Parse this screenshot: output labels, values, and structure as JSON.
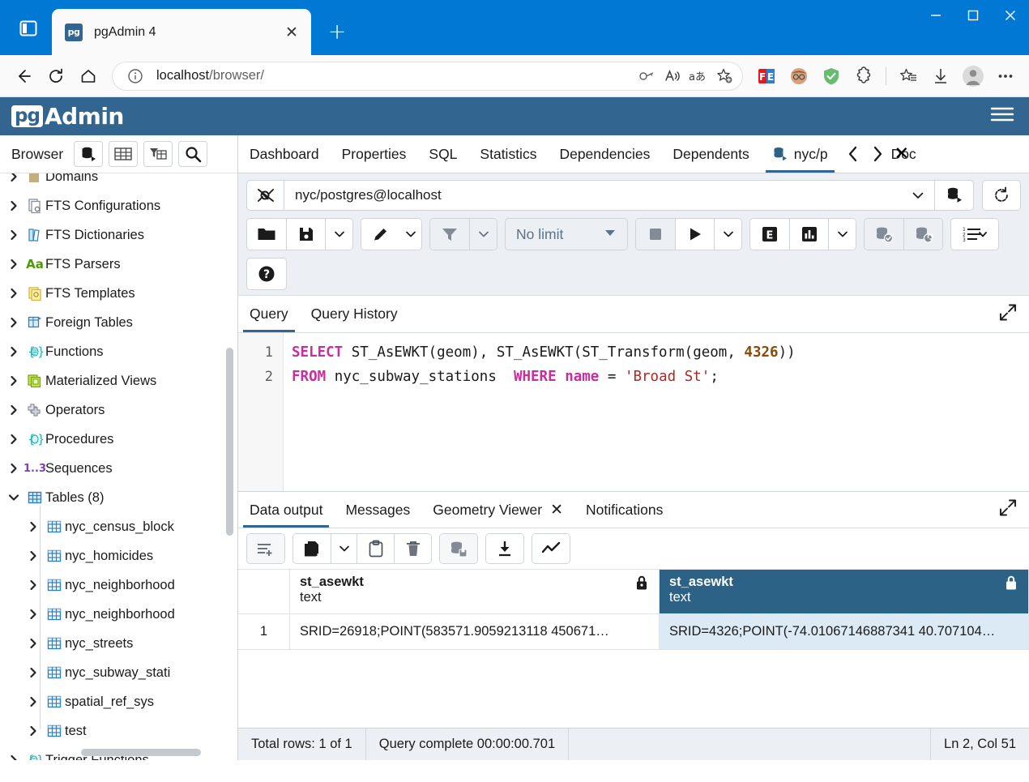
{
  "browser": {
    "tab": {
      "title": "pgAdmin 4",
      "favicon_label": "pg",
      "close_label": "✕"
    },
    "new_tab_label": "+",
    "window_controls": {
      "minimize": "—",
      "maximize": "☐",
      "close": "✕"
    },
    "url": {
      "host": "localhost",
      "path": "/browser/"
    },
    "icons": {
      "tab_list": "tab-list-icon",
      "back": "back-arrow-icon",
      "refresh": "refresh-icon",
      "home": "home-icon",
      "info": "info-icon",
      "key": "password-key-icon",
      "read_aloud": "read-aloud-icon",
      "translate": "translate-icon",
      "add_favorite": "add-favorite-star-icon",
      "ext_f3": "fe-extension-icon",
      "ext_avatar": "avatar-extension-icon",
      "ext_shield": "adguard-shield-icon",
      "ext_puzzle": "extensions-puzzle-icon",
      "collections": "collections-star-icon",
      "downloads": "downloads-icon",
      "profile": "profile-avatar-icon",
      "settings_more": "more-options-icon"
    }
  },
  "pgadmin": {
    "brand_pg": "pg",
    "brand_admin": "Admin",
    "hamburger": "menu-icon"
  },
  "sidebar": {
    "title": "Browser",
    "buttons": [
      {
        "name": "object-explorer-button",
        "icon": "database-stack-icon"
      },
      {
        "name": "view-data-button",
        "icon": "table-grid-icon"
      },
      {
        "name": "filter-button",
        "icon": "filter-table-icon"
      },
      {
        "name": "search-objects-button",
        "icon": "search-icon"
      }
    ],
    "tree": [
      {
        "label": "Domains",
        "icon": "domain-icon",
        "expanded": false,
        "indent": 0,
        "clipped": true
      },
      {
        "label": "FTS Configurations",
        "icon": "fts-config-icon",
        "expanded": false,
        "indent": 0
      },
      {
        "label": "FTS Dictionaries",
        "icon": "fts-dictionary-icon",
        "expanded": false,
        "indent": 0
      },
      {
        "label": "FTS Parsers",
        "icon": "fts-parser-icon",
        "expanded": false,
        "indent": 0
      },
      {
        "label": "FTS Templates",
        "icon": "fts-template-icon",
        "expanded": false,
        "indent": 0
      },
      {
        "label": "Foreign Tables",
        "icon": "foreign-table-icon",
        "expanded": false,
        "indent": 0
      },
      {
        "label": "Functions",
        "icon": "function-icon",
        "expanded": false,
        "indent": 0
      },
      {
        "label": "Materialized Views",
        "icon": "materialized-view-icon",
        "expanded": false,
        "indent": 0
      },
      {
        "label": "Operators",
        "icon": "operator-icon",
        "expanded": false,
        "indent": 0
      },
      {
        "label": "Procedures",
        "icon": "procedure-icon",
        "expanded": false,
        "indent": 0
      },
      {
        "label": "Sequences",
        "icon": "sequence-icon",
        "expanded": false,
        "indent": 0
      },
      {
        "label": "Tables (8)",
        "icon": "tables-icon",
        "expanded": true,
        "indent": 0
      },
      {
        "label": "nyc_census_block",
        "icon": "table-icon",
        "expanded": false,
        "indent": 1
      },
      {
        "label": "nyc_homicides",
        "icon": "table-icon",
        "expanded": false,
        "indent": 1
      },
      {
        "label": "nyc_neighborhood",
        "icon": "table-icon",
        "expanded": false,
        "indent": 1
      },
      {
        "label": "nyc_neighborhood",
        "icon": "table-icon",
        "expanded": false,
        "indent": 1
      },
      {
        "label": "nyc_streets",
        "icon": "table-icon",
        "expanded": false,
        "indent": 1
      },
      {
        "label": "nyc_subway_stati",
        "icon": "table-icon",
        "expanded": false,
        "indent": 1
      },
      {
        "label": "spatial_ref_sys",
        "icon": "table-icon",
        "expanded": false,
        "indent": 1
      },
      {
        "label": "test",
        "icon": "table-icon",
        "expanded": false,
        "indent": 1
      },
      {
        "label": "Trigger Functions",
        "icon": "trigger-function-icon",
        "expanded": false,
        "indent": 0
      }
    ]
  },
  "object_tabs": {
    "items": [
      {
        "label": "Dashboard",
        "active": false
      },
      {
        "label": "Properties",
        "active": false
      },
      {
        "label": "SQL",
        "active": false
      },
      {
        "label": "Statistics",
        "active": false
      },
      {
        "label": "Dependencies",
        "active": false
      },
      {
        "label": "Dependents",
        "active": false
      },
      {
        "label": "nyc/p",
        "active": true,
        "icon": "database-stack-icon"
      }
    ],
    "nav_prev": "‹",
    "nav_next": "›",
    "clipped_text": "Doc",
    "close_mark": "✕"
  },
  "query_tool": {
    "connection": {
      "value": "nyc/postgres@localhost",
      "connect_icon": "plug-connection-icon",
      "caret": "chevron-down-icon",
      "db_icon": "database-stack-icon"
    },
    "refresh_button": "reset-rotate-icon",
    "toolbar": [
      {
        "name": "open-file-button",
        "icon": "folder-open-icon",
        "group": 1
      },
      {
        "name": "save-file-button",
        "icon": "save-floppy-icon",
        "group": 1
      },
      {
        "name": "save-file-dropdown",
        "icon": "chevron-down-icon",
        "group": 1,
        "caret": true
      },
      {
        "name": "edit-button",
        "icon": "pencil-edit-icon",
        "group": 2
      },
      {
        "name": "edit-dropdown",
        "icon": "chevron-down-icon",
        "group": 2,
        "caret": true
      },
      {
        "name": "filter-button",
        "icon": "filter-funnel-icon",
        "group": 3,
        "disabled": true
      },
      {
        "name": "filter-dropdown",
        "icon": "chevron-down-icon",
        "group": 3,
        "caret": true,
        "disabled": true
      },
      {
        "name": "stop-query-button",
        "icon": "stop-square-icon",
        "group": 5,
        "disabled": true
      },
      {
        "name": "execute-query-button",
        "icon": "play-triangle-icon",
        "group": 5
      },
      {
        "name": "execute-dropdown",
        "icon": "chevron-down-icon",
        "group": 5,
        "caret": true
      },
      {
        "name": "explain-button",
        "icon": "explain-e-icon",
        "group": 6
      },
      {
        "name": "explain-analyze-button",
        "icon": "explain-chart-icon",
        "group": 6
      },
      {
        "name": "explain-dropdown",
        "icon": "chevron-down-icon",
        "group": 6,
        "caret": true
      },
      {
        "name": "commit-button",
        "icon": "commit-database-check-icon",
        "group": 7,
        "disabled": true
      },
      {
        "name": "rollback-button",
        "icon": "rollback-database-icon",
        "group": 7,
        "disabled": true
      },
      {
        "name": "macros-button",
        "icon": "macro-list-icon",
        "group": 8
      },
      {
        "name": "help-button",
        "icon": "help-question-icon",
        "group": 9
      }
    ],
    "row_limit": {
      "label": "No limit",
      "caret": "▼"
    },
    "editor_tabs": [
      {
        "label": "Query",
        "active": true
      },
      {
        "label": "Query History",
        "active": false
      }
    ],
    "expand_icon": "expand-diagonal-icon",
    "sql_lines": [
      {
        "number": "1",
        "tokens": [
          {
            "t": "SELECT",
            "c": "kw"
          },
          {
            "t": " ST_AsEWKT(geom), ST_AsEWKT(ST_Transform(geom, ",
            "c": ""
          },
          {
            "t": "4326",
            "c": "num"
          },
          {
            "t": "))",
            "c": ""
          }
        ]
      },
      {
        "number": "2",
        "tokens": [
          {
            "t": "FROM",
            "c": "kw"
          },
          {
            "t": " nyc_subway_stations  ",
            "c": ""
          },
          {
            "t": "WHERE",
            "c": "kw"
          },
          {
            "t": " ",
            "c": ""
          },
          {
            "t": "name",
            "c": "kw"
          },
          {
            "t": " = ",
            "c": ""
          },
          {
            "t": "'Broad St'",
            "c": "str"
          },
          {
            "t": ";",
            "c": ""
          }
        ]
      }
    ]
  },
  "output": {
    "tabs": [
      {
        "label": "Data output",
        "active": true,
        "closable": false
      },
      {
        "label": "Messages",
        "active": false,
        "closable": false
      },
      {
        "label": "Geometry Viewer",
        "active": false,
        "closable": true,
        "close": "✕"
      },
      {
        "label": "Notifications",
        "active": false,
        "closable": false
      }
    ],
    "expand_icon": "expand-diagonal-icon",
    "grid_toolbar": [
      {
        "name": "add-row-button",
        "icon": "add-row-icon",
        "group": 1,
        "disabled": true
      },
      {
        "name": "copy-button",
        "icon": "copy-pages-icon",
        "group": 2
      },
      {
        "name": "copy-dropdown",
        "icon": "chevron-down-icon",
        "group": 2,
        "caret": true
      },
      {
        "name": "paste-button",
        "icon": "paste-clipboard-icon",
        "group": 2
      },
      {
        "name": "delete-row-button",
        "icon": "trash-delete-icon",
        "group": 2
      },
      {
        "name": "save-data-button",
        "icon": "save-database-icon",
        "group": 3,
        "disabled": true
      },
      {
        "name": "download-csv-button",
        "icon": "download-arrow-icon",
        "group": 4
      },
      {
        "name": "graph-visualiser-button",
        "icon": "graph-line-icon",
        "group": 5
      }
    ],
    "columns": [
      {
        "name": "st_asewkt",
        "type": "text",
        "selected": false,
        "lock_icon": "lock-icon"
      },
      {
        "name": "st_asewkt",
        "type": "text",
        "selected": true,
        "lock_icon": "lock-icon"
      }
    ],
    "rows": [
      {
        "number": "1",
        "cells": [
          {
            "value": "SRID=26918;POINT(583571.9059213118 450671…",
            "selected": false
          },
          {
            "value": "SRID=4326;POINT(-74.01067146887341 40.707104…",
            "selected": true
          }
        ]
      }
    ],
    "status": {
      "total_rows": "Total rows: 1 of 1",
      "query_status": "Query complete 00:00:00.701",
      "cursor_position": "Ln 2, Col 51"
    }
  },
  "colors": {
    "browser_blue": "#0078d4",
    "pg_header": "#326690",
    "accent": "#326690",
    "selected_header": "#2d6287",
    "selected_cell": "#dbeaf4",
    "keyword": "#c72fa0",
    "number": "#8a4b08",
    "string": "#b3261e"
  }
}
